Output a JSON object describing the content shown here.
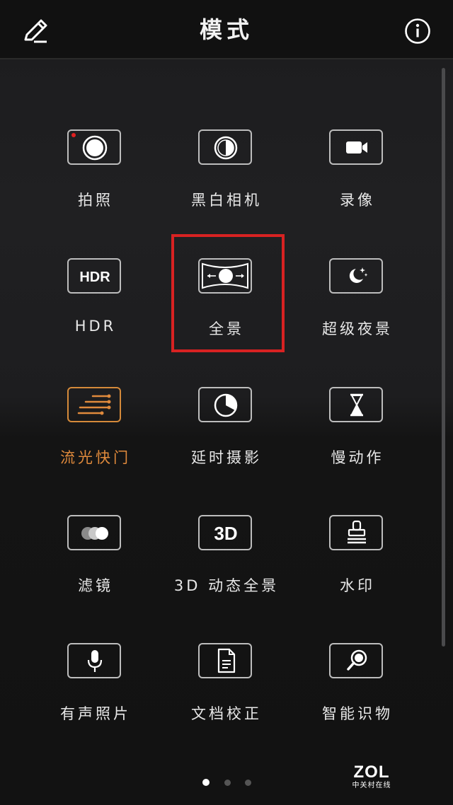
{
  "header": {
    "title": "模式"
  },
  "modes": [
    {
      "id": "photo",
      "label": "拍照",
      "icon": "shutter-icon"
    },
    {
      "id": "monochrome",
      "label": "黑白相机",
      "icon": "half-circle-icon"
    },
    {
      "id": "video",
      "label": "录像",
      "icon": "video-camera-icon"
    },
    {
      "id": "hdr",
      "label": "HDR",
      "icon": "hdr-icon",
      "icon_text": "HDR"
    },
    {
      "id": "panorama",
      "label": "全景",
      "icon": "panorama-icon"
    },
    {
      "id": "super-night",
      "label": "超级夜景",
      "icon": "moon-stars-icon"
    },
    {
      "id": "light-painting",
      "label": "流光快门",
      "icon": "light-trails-icon"
    },
    {
      "id": "time-lapse",
      "label": "延时摄影",
      "icon": "timer-dial-icon"
    },
    {
      "id": "slow-mo",
      "label": "慢动作",
      "icon": "hourglass-icon"
    },
    {
      "id": "filter",
      "label": "滤镜",
      "icon": "overlapping-circles-icon"
    },
    {
      "id": "3d-panorama",
      "label": "3D 动态全景",
      "icon": "3d-icon",
      "icon_text": "3D"
    },
    {
      "id": "watermark",
      "label": "水印",
      "icon": "stamp-icon"
    },
    {
      "id": "audio-photo",
      "label": "有声照片",
      "icon": "microphone-icon"
    },
    {
      "id": "document",
      "label": "文档校正",
      "icon": "document-icon"
    },
    {
      "id": "object-recognition",
      "label": "智能识物",
      "icon": "magnifier-icon"
    }
  ],
  "active_mode": "流光快门",
  "highlighted_mode": "全景",
  "pager": {
    "pages": 3,
    "current": 1
  },
  "watermark": {
    "logo": "ZOL",
    "subtitle": "中关村在线"
  },
  "colors": {
    "background": "#1c1c1e",
    "header": "#111111",
    "icon_border": "#bdbdbd",
    "active_accent": "#e08a3c",
    "highlight_box": "#d82222",
    "record_dot": "#e02020"
  }
}
